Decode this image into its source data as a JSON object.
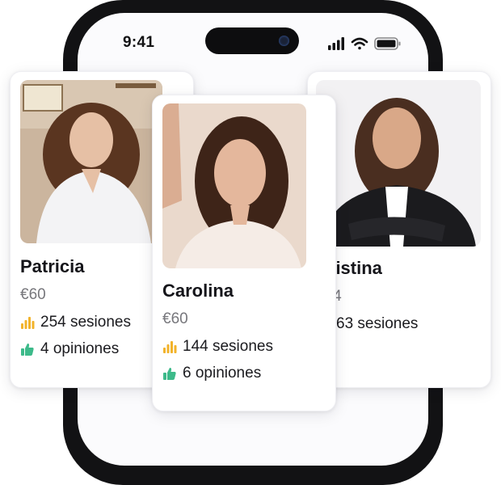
{
  "status_bar": {
    "time": "9:41"
  },
  "therapists": [
    {
      "name": "Patricia",
      "price": "€60",
      "sessions": "254 sesiones",
      "reviews": "4 opiniones"
    },
    {
      "name": "Carolina",
      "price": "€60",
      "sessions": "144 sesiones",
      "reviews": "6 opiniones"
    },
    {
      "name": "Cristina",
      "price": "€44",
      "sessions": "63 sesiones"
    }
  ],
  "colors": {
    "sessions_icon": "#f2b32b",
    "reviews_icon": "#3dba8a"
  },
  "icons": [
    "signal-icon",
    "wifi-icon",
    "battery-icon",
    "bar-chart-icon",
    "thumbs-up-icon"
  ]
}
